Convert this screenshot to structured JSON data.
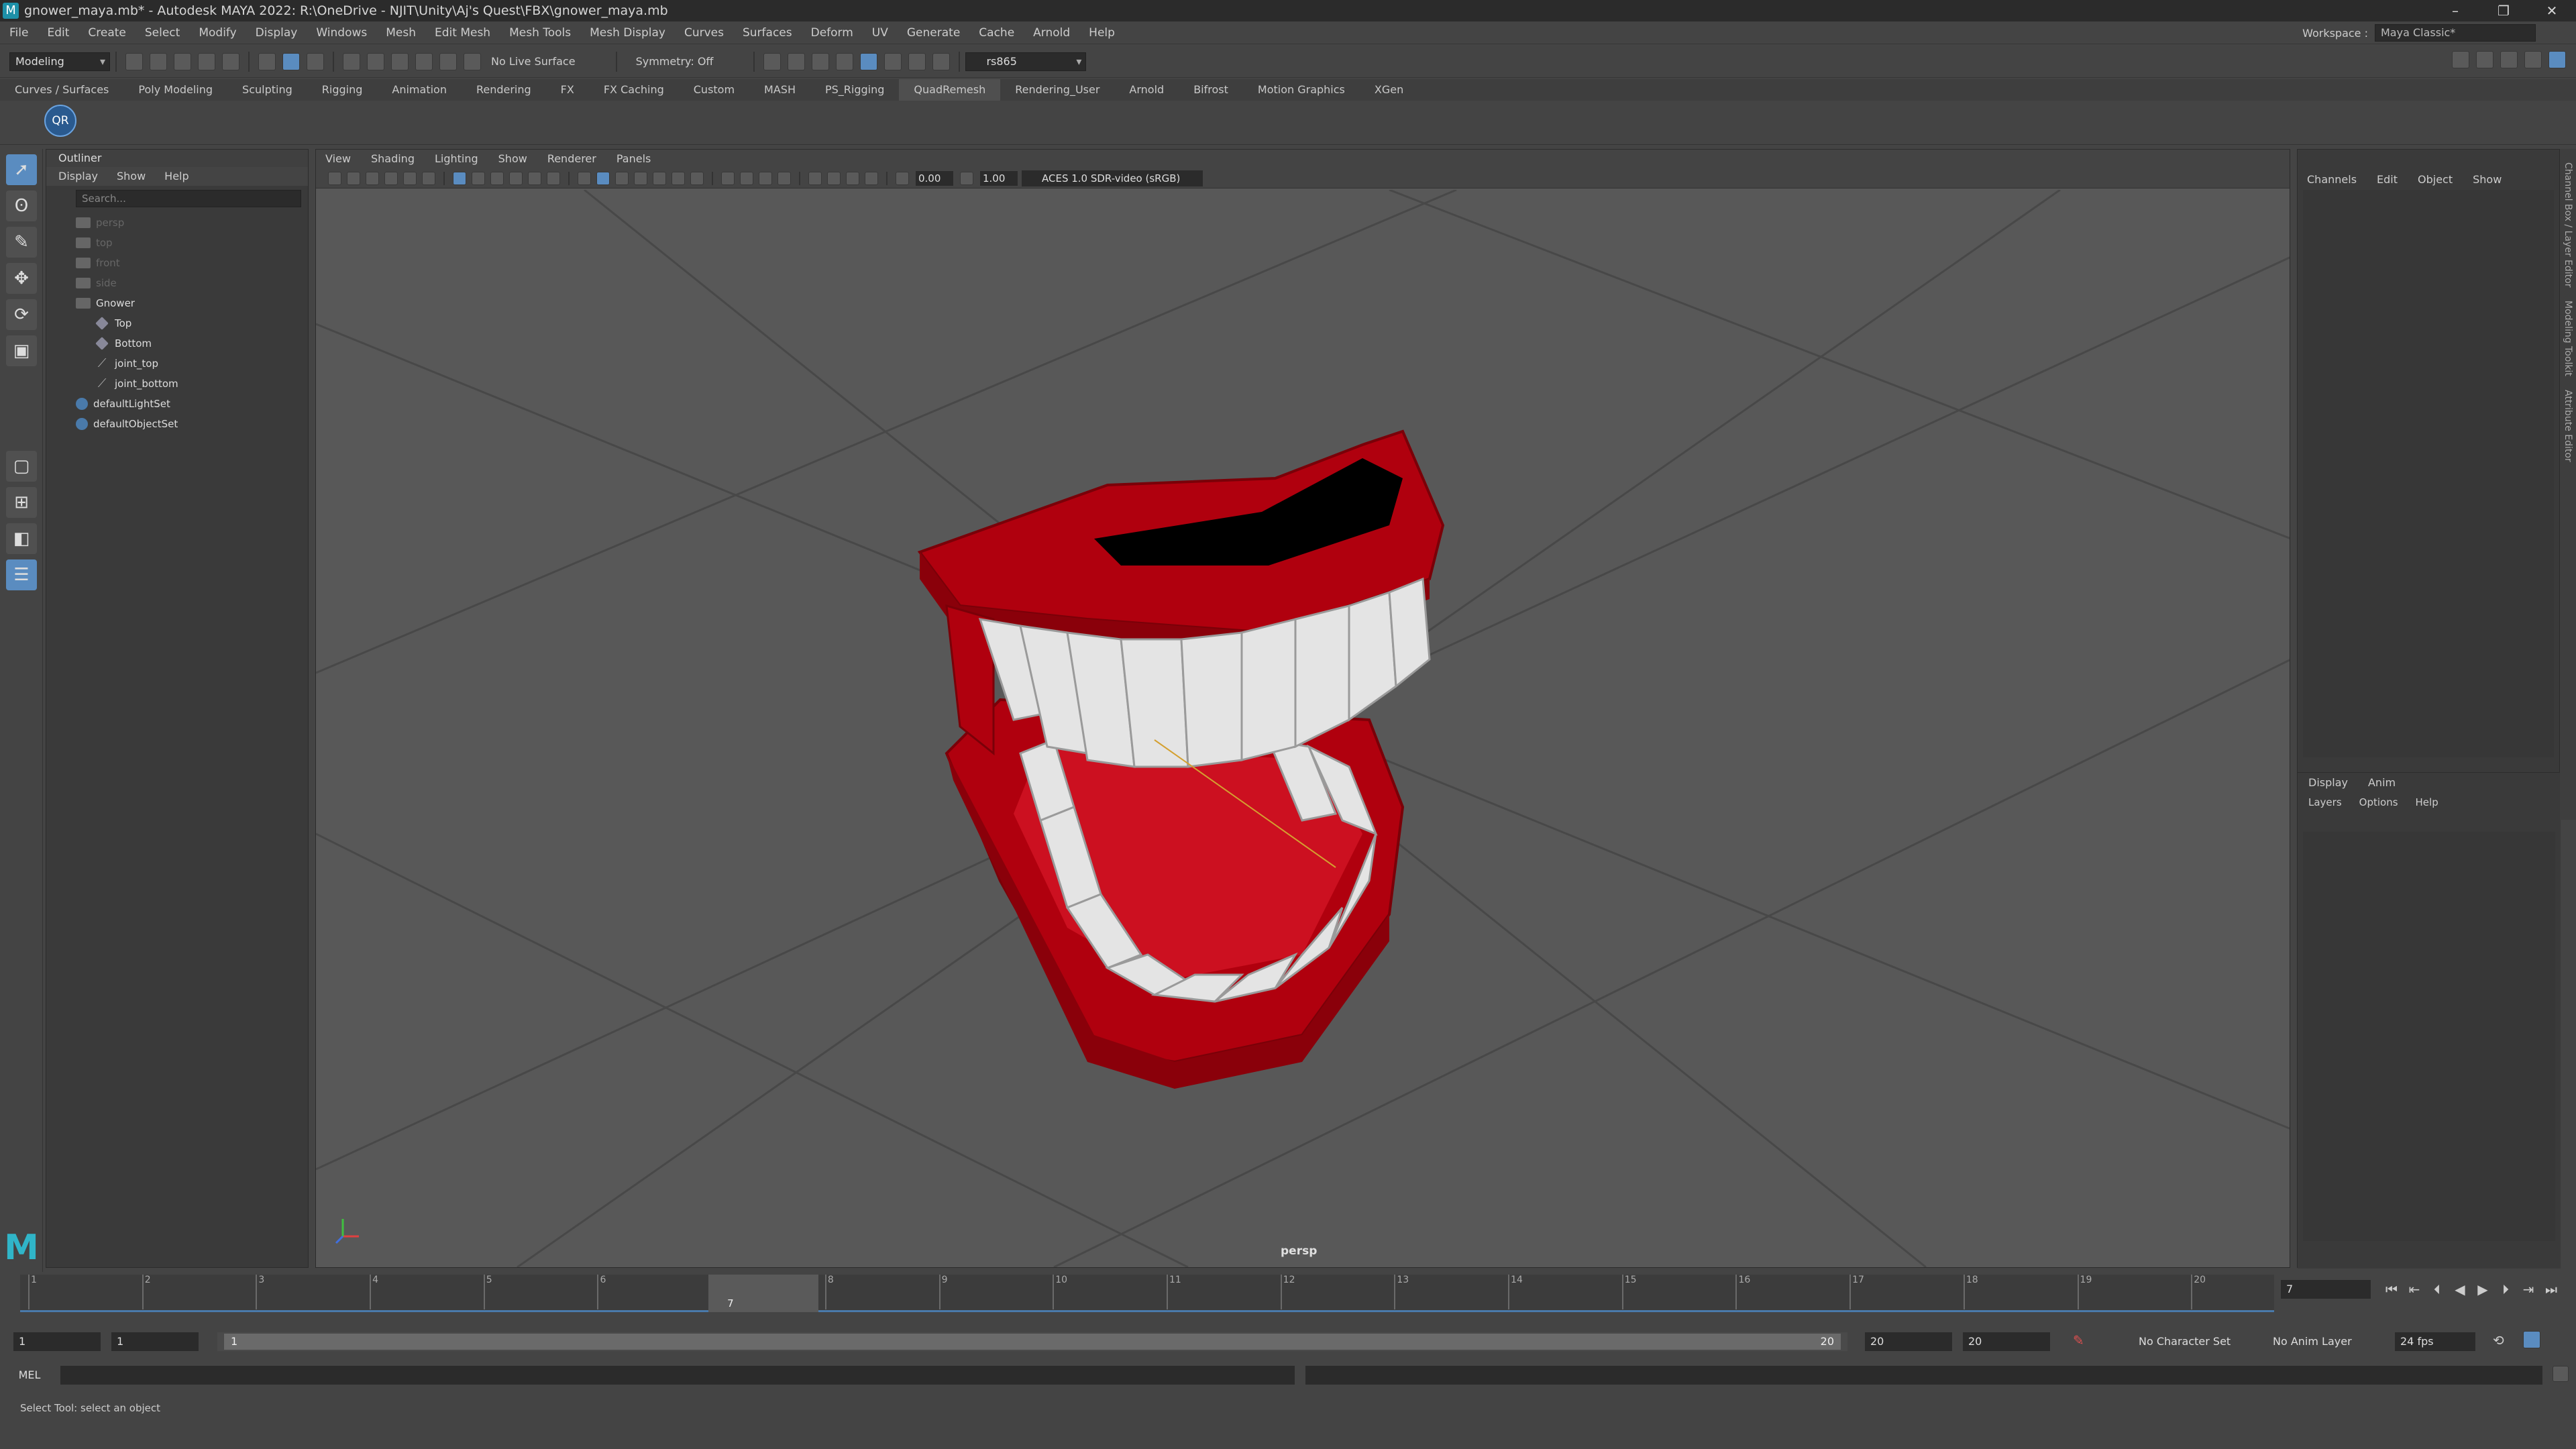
{
  "titlebar": {
    "title": "gnower_maya.mb* - Autodesk MAYA 2022: R:\\OneDrive - NJIT\\Unity\\Aj's Quest\\FBX\\gnower_maya.mb"
  },
  "menu": [
    "File",
    "Edit",
    "Create",
    "Select",
    "Modify",
    "Display",
    "Windows",
    "Mesh",
    "Edit Mesh",
    "Mesh Tools",
    "Mesh Display",
    "Curves",
    "Surfaces",
    "Deform",
    "UV",
    "Generate",
    "Cache",
    "Arnold",
    "Help"
  ],
  "workspace": {
    "label": "Workspace :",
    "value": "Maya Classic*"
  },
  "statusline": {
    "mode": "Modeling",
    "live_surface": "No Live Surface",
    "symmetry": "Symmetry: Off",
    "renderer": "rs865"
  },
  "shelf_tabs": [
    "Curves / Surfaces",
    "Poly Modeling",
    "Sculpting",
    "Rigging",
    "Animation",
    "Rendering",
    "FX",
    "FX Caching",
    "Custom",
    "MASH",
    "PS_Rigging",
    "QuadRemesh",
    "Rendering_User",
    "Arnold",
    "Bifrost",
    "Motion Graphics",
    "XGen"
  ],
  "shelf_active": "QuadRemesh",
  "shelf_button": "QR",
  "outliner": {
    "title": "Outliner",
    "menu": [
      "Display",
      "Show",
      "Help"
    ],
    "search_placeholder": "Search...",
    "items": [
      {
        "label": "persp",
        "type": "camera",
        "dim": true,
        "indent": 0
      },
      {
        "label": "top",
        "type": "camera",
        "dim": true,
        "indent": 0
      },
      {
        "label": "front",
        "type": "camera",
        "dim": true,
        "indent": 0
      },
      {
        "label": "side",
        "type": "camera",
        "dim": true,
        "indent": 0
      },
      {
        "label": "Gnower",
        "type": "group",
        "dim": false,
        "indent": 0
      },
      {
        "label": "Top",
        "type": "mesh",
        "dim": false,
        "indent": 1
      },
      {
        "label": "Bottom",
        "type": "mesh",
        "dim": false,
        "indent": 1
      },
      {
        "label": "joint_top",
        "type": "joint",
        "dim": false,
        "indent": 1
      },
      {
        "label": "joint_bottom",
        "type": "joint",
        "dim": false,
        "indent": 1
      },
      {
        "label": "defaultLightSet",
        "type": "set",
        "dim": false,
        "indent": 0
      },
      {
        "label": "defaultObjectSet",
        "type": "set",
        "dim": false,
        "indent": 0
      }
    ]
  },
  "viewport": {
    "menu": [
      "View",
      "Shading",
      "Lighting",
      "Show",
      "Renderer",
      "Panels"
    ],
    "exposure": "0.00",
    "gamma": "1.00",
    "color_management": "ACES 1.0 SDR-video (sRGB)",
    "camera_label": "persp",
    "colors": {
      "bg": "#585858",
      "grid": "#4a4a4a",
      "gum": "#b0000e",
      "tooth": "#e4e4e4"
    }
  },
  "channelbox": {
    "menu": [
      "Channels",
      "Edit",
      "Object",
      "Show"
    ],
    "layer_tabs": [
      "Display",
      "Anim"
    ],
    "layer_menu": [
      "Layers",
      "Options",
      "Help"
    ]
  },
  "side_tabs": [
    "Channel Box / Layer Editor",
    "Modeling Toolkit",
    "Attribute Editor"
  ],
  "timeline": {
    "ticks": [
      "1",
      "2",
      "3",
      "4",
      "5",
      "6",
      "7",
      "8",
      "9",
      "10",
      "11",
      "12",
      "13",
      "14",
      "15",
      "16",
      "17",
      "18",
      "19",
      "20"
    ],
    "current": "7"
  },
  "range": {
    "start": "1",
    "playback_start": "1",
    "slider_start": "1",
    "slider_end": "20",
    "playback_end": "20",
    "end": "20",
    "character_set": "No Character Set",
    "anim_layer": "No Anim Layer",
    "fps": "24 fps"
  },
  "cmdline": {
    "label": "MEL"
  },
  "helpline": {
    "text": "Select Tool: select an object"
  }
}
